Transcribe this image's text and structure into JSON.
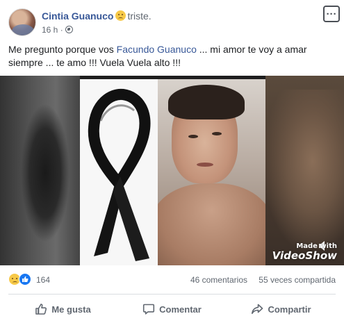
{
  "post": {
    "author": "Cintia Guanuco",
    "feeling": "triste.",
    "feeling_icon": "sad-face-icon",
    "time": "16 h",
    "separator": "·",
    "audience_icon": "globe-icon",
    "more_icon": "ellipsis-icon",
    "more_label": "···",
    "text_before": "Me pregunto porque vos ",
    "mention": "Facundo Guanuco",
    "text_after": " ... mi amor te voy a amar siempre ... te amo !!! Vuela Vuela alto !!!",
    "link_color": "#385898"
  },
  "media": {
    "watermark_line1": "Made with",
    "watermark_line2": "VideoShow",
    "speaker_icon": "speaker-icon"
  },
  "stats": {
    "reactions": [
      "sad-reaction-icon",
      "like-reaction-icon"
    ],
    "reaction_count": "164",
    "comments": "46 comentarios",
    "shares": "55 veces compartida"
  },
  "actions": [
    {
      "label": "Me gusta",
      "icon": "thumbs-up-icon"
    },
    {
      "label": "Comentar",
      "icon": "comment-icon"
    },
    {
      "label": "Compartir",
      "icon": "share-icon"
    }
  ],
  "colors": {
    "accent": "#385898",
    "like_blue": "#1877f2",
    "muted": "#606770"
  }
}
